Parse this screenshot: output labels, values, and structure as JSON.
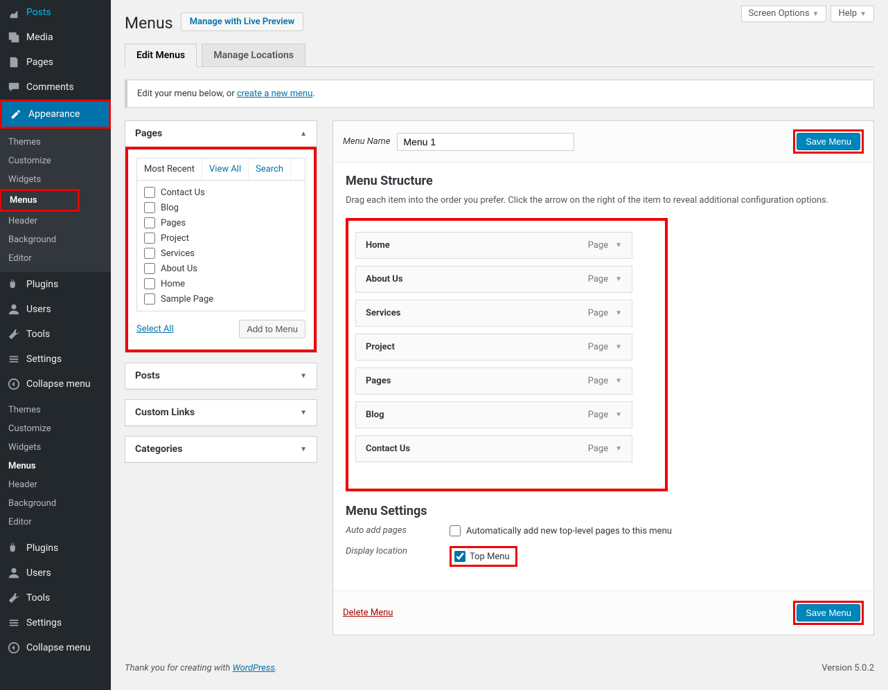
{
  "topbar": {
    "screen_options": "Screen Options",
    "help": "Help"
  },
  "sidebar": {
    "posts": "Posts",
    "media": "Media",
    "pages": "Pages",
    "comments": "Comments",
    "appearance": "Appearance",
    "sub": {
      "themes": "Themes",
      "customize": "Customize",
      "widgets": "Widgets",
      "menus": "Menus",
      "header": "Header",
      "background": "Background",
      "editor": "Editor"
    },
    "plugins": "Plugins",
    "users": "Users",
    "tools": "Tools",
    "settings": "Settings",
    "collapse": "Collapse menu"
  },
  "page_title": "Menus",
  "live_preview": "Manage with Live Preview",
  "tabs": {
    "edit": "Edit Menus",
    "locations": "Manage Locations"
  },
  "notice": {
    "prefix": "Edit your menu below, or ",
    "link": "create a new menu",
    "suffix": "."
  },
  "accordion": {
    "pages": {
      "title": "Pages",
      "tabs": {
        "recent": "Most Recent",
        "all": "View All",
        "search": "Search"
      },
      "items": [
        "Contact Us",
        "Blog",
        "Pages",
        "Project",
        "Services",
        "About Us",
        "Home",
        "Sample Page"
      ],
      "select_all": "Select All",
      "add": "Add to Menu"
    },
    "posts": "Posts",
    "custom_links": "Custom Links",
    "categories": "Categories"
  },
  "menu_name_label": "Menu Name",
  "menu_name_value": "Menu 1",
  "save_menu": "Save Menu",
  "structure": {
    "heading": "Menu Structure",
    "desc": "Drag each item into the order you prefer. Click the arrow on the right of the item to reveal additional configuration options.",
    "items": [
      {
        "label": "Home",
        "type": "Page"
      },
      {
        "label": "About Us",
        "type": "Page"
      },
      {
        "label": "Services",
        "type": "Page"
      },
      {
        "label": "Project",
        "type": "Page"
      },
      {
        "label": "Pages",
        "type": "Page"
      },
      {
        "label": "Blog",
        "type": "Page"
      },
      {
        "label": "Contact Us",
        "type": "Page"
      }
    ]
  },
  "settings": {
    "heading": "Menu Settings",
    "auto_label": "Auto add pages",
    "auto_text": "Automatically add new top-level pages to this menu",
    "loc_label": "Display location",
    "loc_text": "Top Menu"
  },
  "delete": "Delete Menu",
  "footer": {
    "text": "Thank you for creating with ",
    "link": "WordPress",
    "version": "Version 5.0.2"
  }
}
